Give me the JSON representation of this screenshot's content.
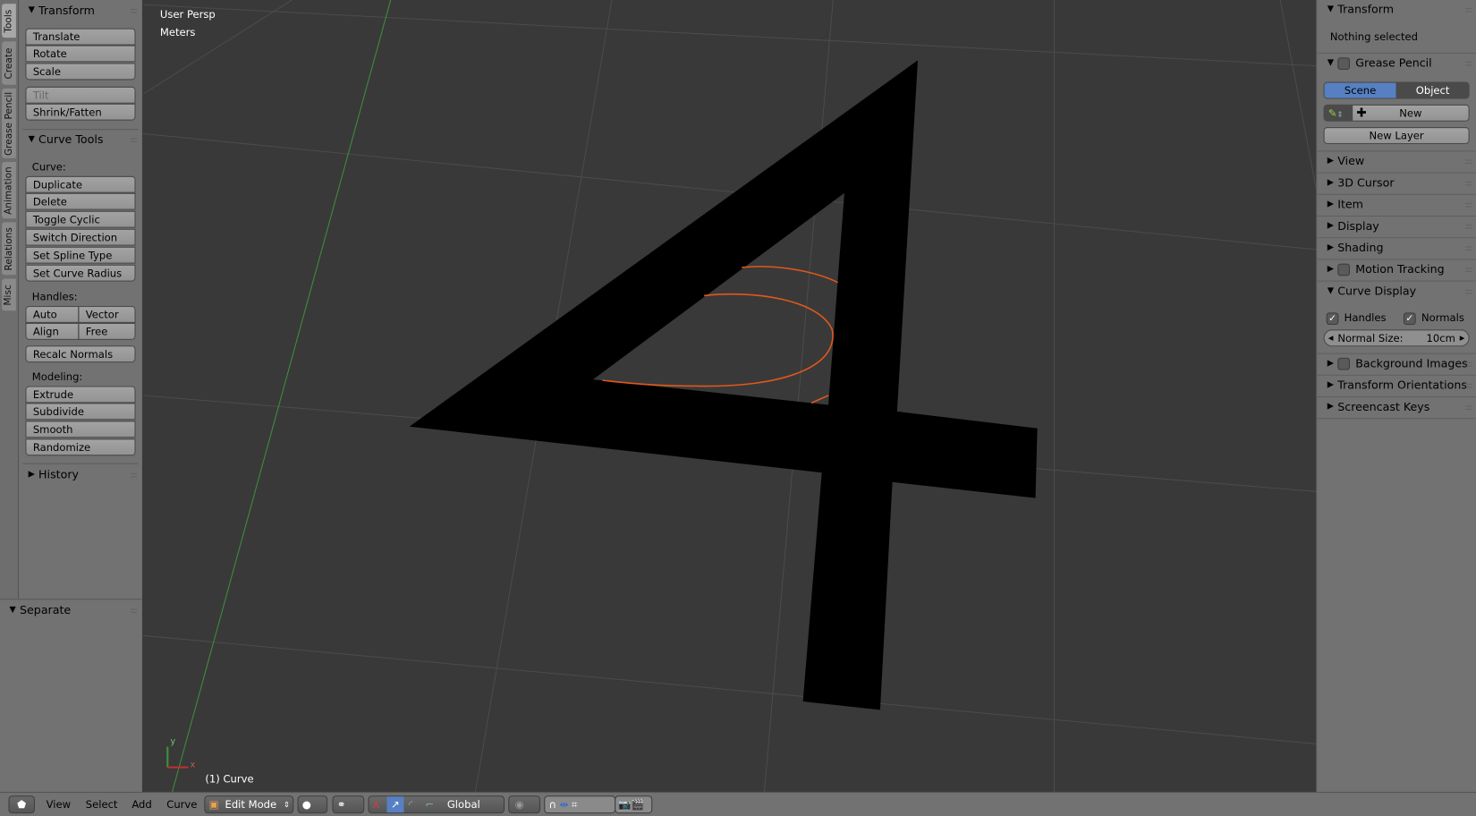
{
  "viewport": {
    "view_name": "User Persp",
    "units": "Meters",
    "object_info": "(1) Curve",
    "axis_x": "x",
    "axis_y": "y"
  },
  "left_tabs": [
    "Tools",
    "Create",
    "Grease Pencil",
    "Animation",
    "Relations",
    "Misc"
  ],
  "left_panel": {
    "transform": {
      "title": "Transform",
      "buttons": [
        "Translate",
        "Rotate",
        "Scale"
      ],
      "tilt": "Tilt",
      "shrink": "Shrink/Fatten"
    },
    "curve_tools": {
      "title": "Curve Tools",
      "curve_label": "Curve:",
      "curve_buttons": [
        "Duplicate",
        "Delete",
        "Toggle Cyclic",
        "Switch Direction",
        "Set Spline Type",
        "Set Curve Radius"
      ],
      "handles_label": "Handles:",
      "handles": [
        "Auto",
        "Vector",
        "Align",
        "Free"
      ],
      "recalc": "Recalc Normals",
      "modeling_label": "Modeling:",
      "modeling_buttons": [
        "Extrude",
        "Subdivide",
        "Smooth",
        "Randomize"
      ]
    },
    "history": "History",
    "operator": "Separate"
  },
  "right_panel": {
    "transform": "Transform",
    "nothing_selected": "Nothing selected",
    "grease_pencil": "Grease Pencil",
    "scene": "Scene",
    "object": "Object",
    "new": "New",
    "new_layer": "New Layer",
    "collapsed": [
      "View",
      "3D Cursor",
      "Item",
      "Display",
      "Shading"
    ],
    "motion_tracking": "Motion Tracking",
    "curve_display": "Curve Display",
    "handles": "Handles",
    "normals": "Normals",
    "normal_size_label": "Normal Size:",
    "normal_size_value": "10cm",
    "background_images": "Background Images",
    "transform_orientations": "Transform Orientations",
    "screencast_keys": "Screencast Keys"
  },
  "header": {
    "menus": [
      "View",
      "Select",
      "Add",
      "Curve"
    ],
    "mode": "Edit Mode",
    "orientation": "Global"
  },
  "colors": {
    "accent": "#5680c2",
    "curve": "#e0581c",
    "grid_y_axis": "#3d8f3d",
    "background": "#393939"
  }
}
